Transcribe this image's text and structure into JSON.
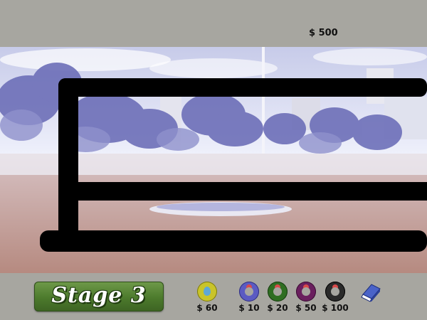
{
  "hud": {
    "money": "$ 500"
  },
  "stage": {
    "label": "Stage 3"
  },
  "towers": [
    {
      "price": "$ 60",
      "ring": "#c9c42a",
      "core": "#5fa7d6",
      "core_shape": "drop"
    },
    {
      "price": "$ 10",
      "ring": "#5b5bc2",
      "core": "#d94a4a",
      "core_shape": "dot"
    },
    {
      "price": "$ 20",
      "ring": "#2f6e22",
      "core": "#d94a4a",
      "core_shape": "dot"
    },
    {
      "price": "$ 50",
      "ring": "#6a1f5e",
      "core": "#d94a4a",
      "core_shape": "dot"
    },
    {
      "price": "$ 100",
      "ring": "#2a2a2a",
      "core": "#d94a4a",
      "core_shape": "dot"
    }
  ],
  "tools": {
    "eraser_icon": "eraser-icon"
  },
  "colors": {
    "panel": "#a7a6a0",
    "track": "#000000",
    "stage_green": "#4c7a2c"
  }
}
